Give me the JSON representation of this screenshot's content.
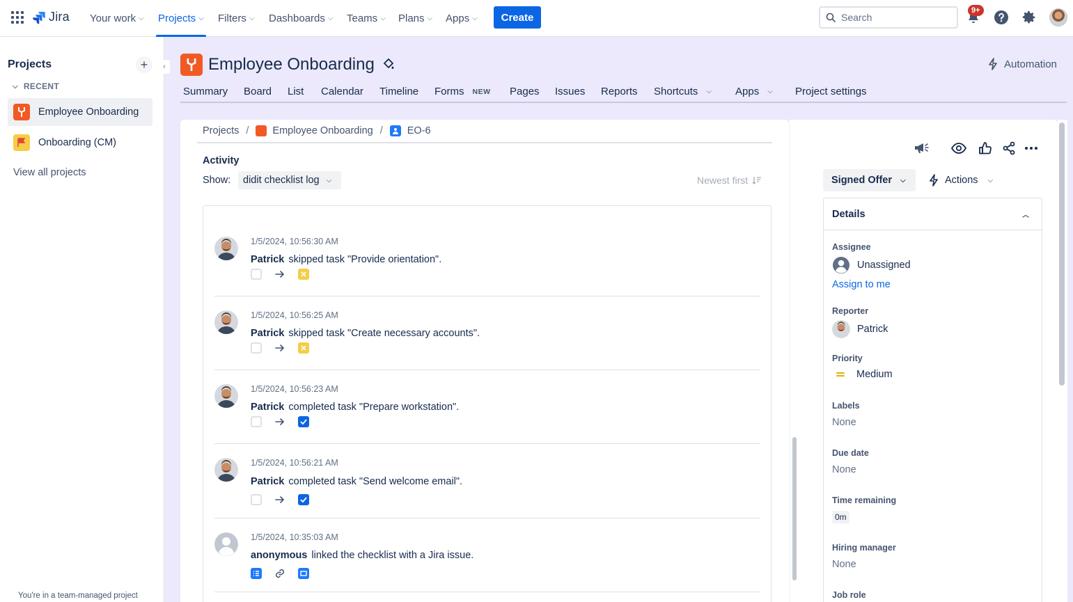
{
  "topnav": {
    "logo_text": "Jira",
    "items": [
      {
        "label": "Your work"
      },
      {
        "label": "Projects"
      },
      {
        "label": "Filters"
      },
      {
        "label": "Dashboards"
      },
      {
        "label": "Teams"
      },
      {
        "label": "Plans"
      },
      {
        "label": "Apps"
      }
    ],
    "active_item": "Projects",
    "create_label": "Create",
    "search_placeholder": "Search",
    "notification_badge": "9+",
    "accent_color": "#0c66e4"
  },
  "sidebar": {
    "title": "Projects",
    "recent_label": "RECENT",
    "projects": [
      {
        "name": "Employee Onboarding",
        "icon_color": "#f15a24"
      },
      {
        "name": "Onboarding (CM)",
        "icon_color": "#f5cd47"
      }
    ],
    "view_all": "View all projects",
    "footer": "You're in a team-managed project"
  },
  "project": {
    "title": "Employee Onboarding",
    "automation_label": "Automation",
    "tabs": [
      {
        "label": "Summary"
      },
      {
        "label": "Board"
      },
      {
        "label": "List"
      },
      {
        "label": "Calendar"
      },
      {
        "label": "Timeline"
      },
      {
        "label": "Forms",
        "badge": "NEW"
      },
      {
        "label": "Pages"
      },
      {
        "label": "Issues"
      },
      {
        "label": "Reports"
      },
      {
        "label": "Shortcuts"
      },
      {
        "label": "Apps"
      },
      {
        "label": "Project settings"
      }
    ]
  },
  "breadcrumb": {
    "root": "Projects",
    "project": "Employee Onboarding",
    "issue": "EO-6"
  },
  "activity": {
    "heading": "Activity",
    "show_label": "Show:",
    "show_value": "didit checklist log",
    "sort_label": "Newest first",
    "entries": [
      {
        "time": "1/5/2024, 10:56:30 AM",
        "user": "Patrick",
        "text": "skipped task \"Provide orientation\".",
        "result": "skipped"
      },
      {
        "time": "1/5/2024, 10:56:25 AM",
        "user": "Patrick",
        "text": "skipped task \"Create necessary accounts\".",
        "result": "skipped"
      },
      {
        "time": "1/5/2024, 10:56:23 AM",
        "user": "Patrick",
        "text": "completed task \"Prepare workstation\".",
        "result": "completed"
      },
      {
        "time": "1/5/2024, 10:56:21 AM",
        "user": "Patrick",
        "text": "completed task \"Send welcome email\".",
        "result": "completed"
      },
      {
        "time": "1/5/2024, 10:35:03 AM",
        "user": "anonymous",
        "text": "linked the checklist with a Jira issue.",
        "result": "linked"
      }
    ]
  },
  "issue_panel": {
    "status": "Signed Offer",
    "actions_label": "Actions",
    "details_heading": "Details",
    "fields": {
      "assignee_label": "Assignee",
      "assignee_value": "Unassigned",
      "assign_to_me": "Assign to me",
      "reporter_label": "Reporter",
      "reporter_value": "Patrick",
      "priority_label": "Priority",
      "priority_value": "Medium",
      "labels_label": "Labels",
      "labels_value": "None",
      "due_date_label": "Due date",
      "due_date_value": "None",
      "time_remaining_label": "Time remaining",
      "time_remaining_value": "0m",
      "hiring_manager_label": "Hiring manager",
      "hiring_manager_value": "None",
      "job_role_label": "Job role"
    }
  }
}
